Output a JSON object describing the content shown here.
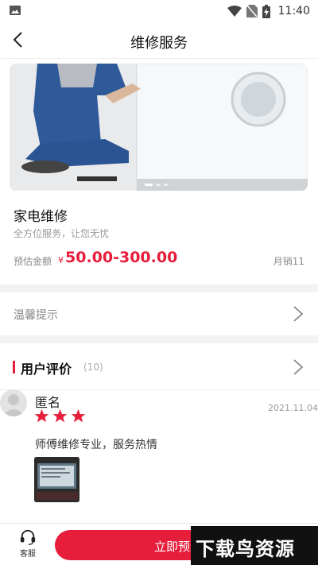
{
  "status_bar": {
    "time": "11:40"
  },
  "navbar": {
    "title": "维修服务"
  },
  "product": {
    "name": "家电维修",
    "subtitle": "全方位服务，让您无忧",
    "price_label": "预估金额",
    "currency": "¥",
    "price_range": "50.00-300.00",
    "sales": "月销11"
  },
  "tips": {
    "label": "温馨提示"
  },
  "reviews": {
    "title": "用户评价",
    "count": "(10)",
    "items": [
      {
        "name": "匿名",
        "date": "2021.11.04",
        "rating": 3,
        "text": "师傅维修专业，服务热情"
      }
    ]
  },
  "bottom_bar": {
    "service_label": "客服",
    "book_label": "立即预约"
  },
  "watermark": {
    "text": "下载鸟资源"
  },
  "colors": {
    "accent": "#e61e3c"
  }
}
